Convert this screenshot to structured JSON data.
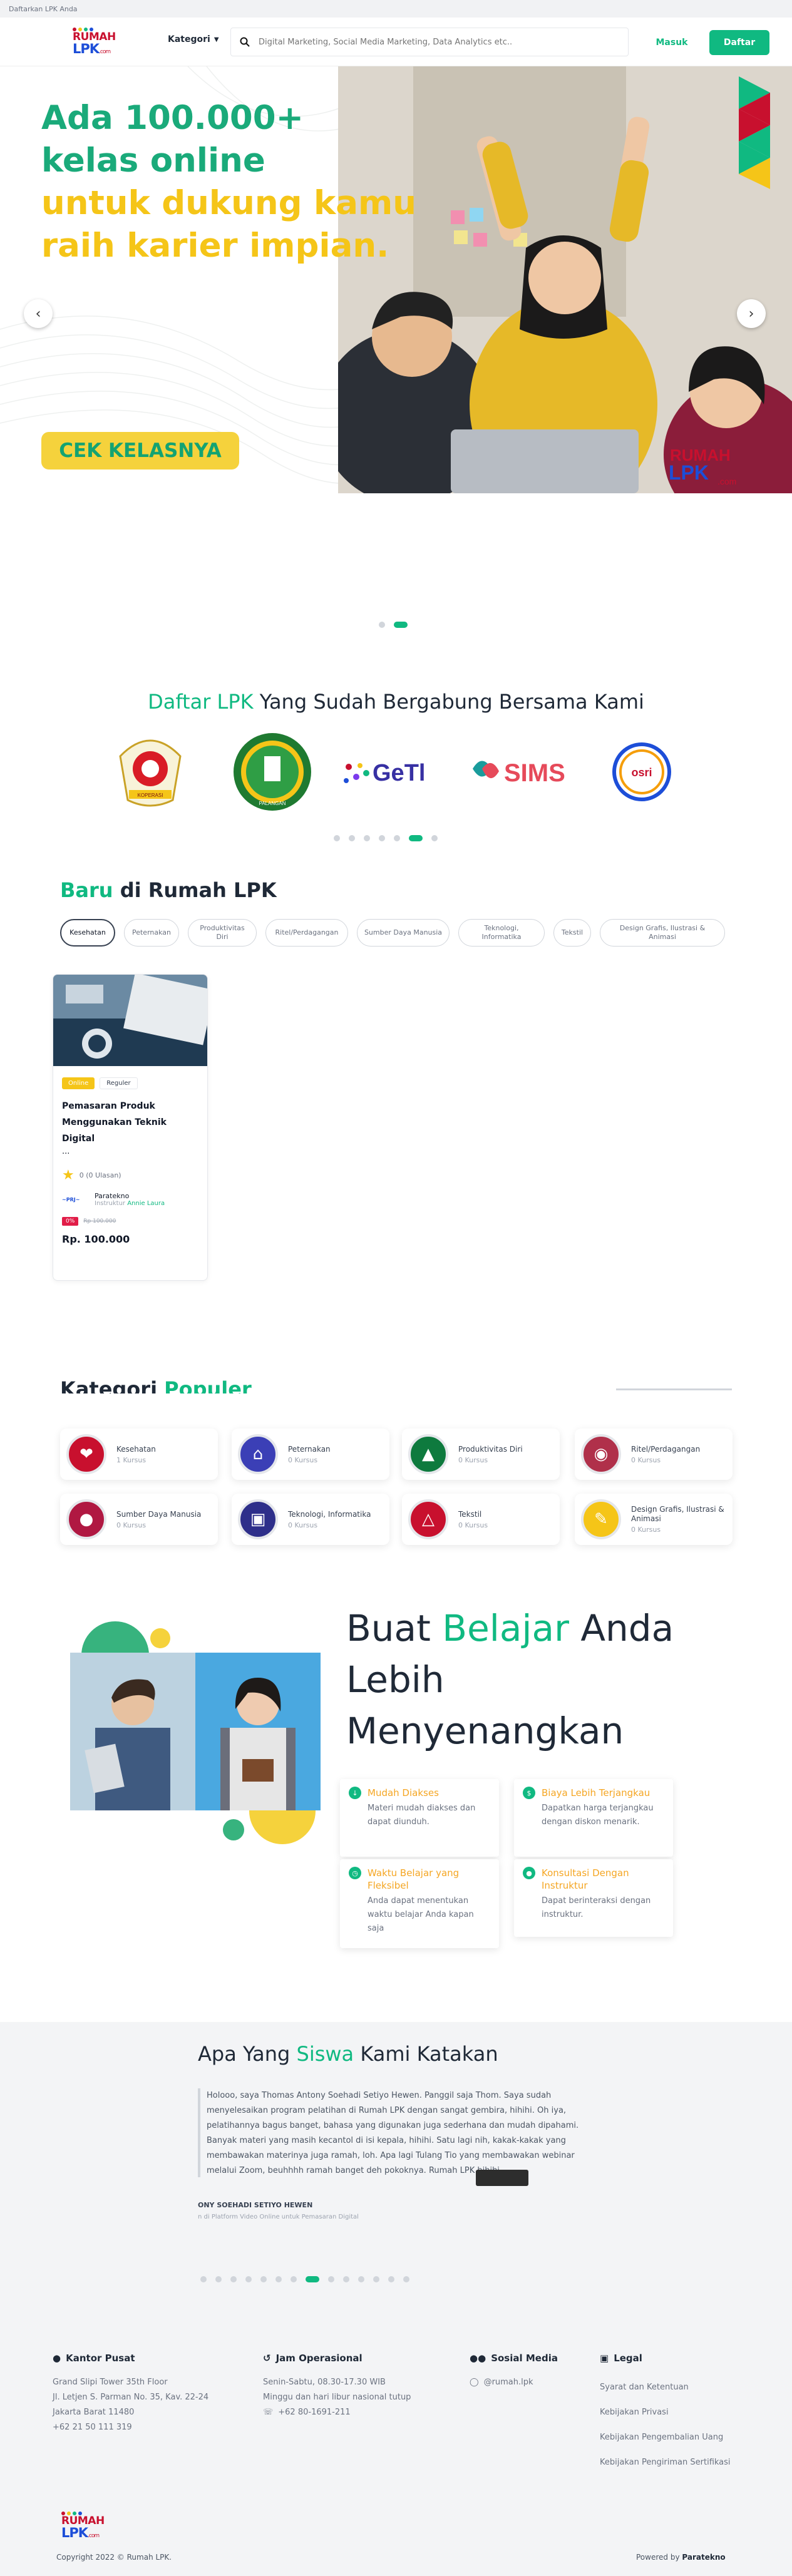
{
  "topbar": {
    "text": "Daftarkan LPK Anda"
  },
  "header": {
    "logo": {
      "line1": "RUMAH",
      "line2": "LPK",
      "suffix": ".com"
    },
    "kategori_label": "Kategori",
    "search_placeholder": "Digital Marketing, Social Media Marketing, Data Analytics etc..",
    "login_label": "Masuk",
    "register_label": "Daftar"
  },
  "hero": {
    "line1": "Ada 100.000+",
    "line2": "kelas online",
    "line3": "untuk dukung kamu",
    "line4": "raih karier impian.",
    "cta": "CEK KELASNYA",
    "brand": {
      "line1": "RUMAH",
      "line2": "LPK",
      "suffix": ".com"
    },
    "dots_total": 2,
    "dots_active": 1
  },
  "lpk_section": {
    "title_accent": "Daftar LPK",
    "title_rest": "Yang Sudah Bergabung Bersama Kami",
    "logos": [
      {
        "name": "seal-logo-1",
        "text": "KOPERASI"
      },
      {
        "name": "seal-logo-2",
        "text": "PALANGAN"
      },
      {
        "name": "getl-logo",
        "text": "GeTl"
      },
      {
        "name": "sims-logo",
        "text": "SIMS"
      },
      {
        "name": "osri-logo",
        "text": "osri"
      }
    ],
    "dots_total": 7,
    "dots_active": 5
  },
  "baru": {
    "title_accent": "Baru",
    "title_rest": "di Rumah LPK",
    "tabs": [
      "Kesehatan",
      "Peternakan",
      "Produktivitas Diri",
      "Ritel/Perdagangan",
      "Sumber Daya Manusia",
      "Teknologi, Informatika",
      "Tekstil",
      "Design Grafis, Ilustrasi & Animasi"
    ],
    "active_tab": 0,
    "course": {
      "badge1": "Online",
      "badge2": "Reguler",
      "title": "Pemasaran Produk Menggunakan Teknik Digital",
      "ellipsis": "...",
      "rating": "0 (0 Ulasan)",
      "provider": "Paratekno",
      "instructor_label": "Instruktur",
      "instructor": "Annie Laura",
      "discount_tag": "0%",
      "old_price": "Rp 100.000",
      "price": "Rp. 100.000"
    }
  },
  "kategori": {
    "title": "Kategori",
    "title_accent": "Populer",
    "items": [
      {
        "name": "Kesehatan",
        "count": "1 Kursus",
        "color": "#c8102e"
      },
      {
        "name": "Peternakan",
        "count": "0 Kursus",
        "color": "#3b3fb6"
      },
      {
        "name": "Produktivitas Diri",
        "count": "0 Kursus",
        "color": "#0e7a3e"
      },
      {
        "name": "Ritel/Perdagangan",
        "count": "0 Kursus",
        "color": "#b0304a"
      },
      {
        "name": "Sumber Daya Manusia",
        "count": "0 Kursus",
        "color": "#b01842"
      },
      {
        "name": "Teknologi, Informatika",
        "count": "0 Kursus",
        "color": "#2e2f8a"
      },
      {
        "name": "Tekstil",
        "count": "0 Kursus",
        "color": "#c8102e"
      },
      {
        "name": "Design Grafis, Ilustrasi & Animasi",
        "count": "0 Kursus",
        "color": "#f5c518"
      }
    ]
  },
  "belajar": {
    "title_a": "Buat",
    "title_accent": "Belajar",
    "title_b": "Anda Lebih",
    "title_c": "Menyenangkan",
    "features": [
      {
        "title": "Mudah Diakses",
        "desc": "Materi mudah diakses dan dapat diunduh."
      },
      {
        "title": "Biaya Lebih Terjangkau",
        "desc": "Dapatkan harga terjangkau dengan diskon menarik."
      },
      {
        "title": "Waktu Belajar yang Fleksibel",
        "desc": "Anda dapat menentukan waktu belajar Anda kapan saja"
      },
      {
        "title": "Konsultasi Dengan Instruktur",
        "desc": "Dapat berinteraksi dengan instruktur."
      }
    ]
  },
  "testimonial": {
    "title_a": "Apa Yang",
    "title_accent": "Siswa",
    "title_b": "Kami Katakan",
    "text": "Holooo, saya Thomas Antony Soehadi Setiyo Hewen. Panggil saja Thom. Saya sudah menyelesaikan program pelatihan di Rumah LPK dengan sangat gembira, hihihi. Oh iya, pelatihannya bagus banget, bahasa yang digunakan juga sederhana dan mudah dipahami. Banyak materi yang masih kecantol di isi kepala, hihihi. Satu lagi nih, kakak-kakak yang membawakan materinya juga ramah, loh. Apa lagi Tulang Tio yang membawakan webinar melalui Zoom, beuhhhh ramah banget deh pokoknya. Rumah LPK hihihi.",
    "name": "ONY SOEHADI SETIYO HEWEN",
    "role": "n di Platform Video Online untuk Pemasaran Digital",
    "dots_total": 14,
    "dots_active": 7
  },
  "footer": {
    "office": {
      "heading": "Kantor Pusat",
      "lines": [
        "Grand Slipi Tower 35th Floor",
        "Jl. Letjen S. Parman No. 35, Kav. 22-24",
        "Jakarta Barat 11480",
        "+62 21 50 111 319"
      ]
    },
    "hours": {
      "heading": "Jam Operasional",
      "lines": [
        "Senin-Sabtu, 08.30-17.30 WIB",
        "Minggu dan hari libur nasional tutup"
      ],
      "phone": "+62 80-1691-211"
    },
    "social": {
      "heading": "Sosial Media",
      "handle": "@rumah.lpk"
    },
    "legal": {
      "heading": "Legal",
      "links": [
        "Syarat dan Ketentuan",
        "Kebijakan Privasi",
        "Kebijakan Pengembalian Uang",
        "Kebijakan Pengiriman Sertifikasi"
      ]
    },
    "logo": {
      "line1": "RUMAH",
      "line2": "LPK",
      "suffix": ".com"
    },
    "copyright": "Copyright 2022 © Rumah LPK.",
    "powered_label": "Powered by",
    "powered_by": "Paratekno"
  }
}
